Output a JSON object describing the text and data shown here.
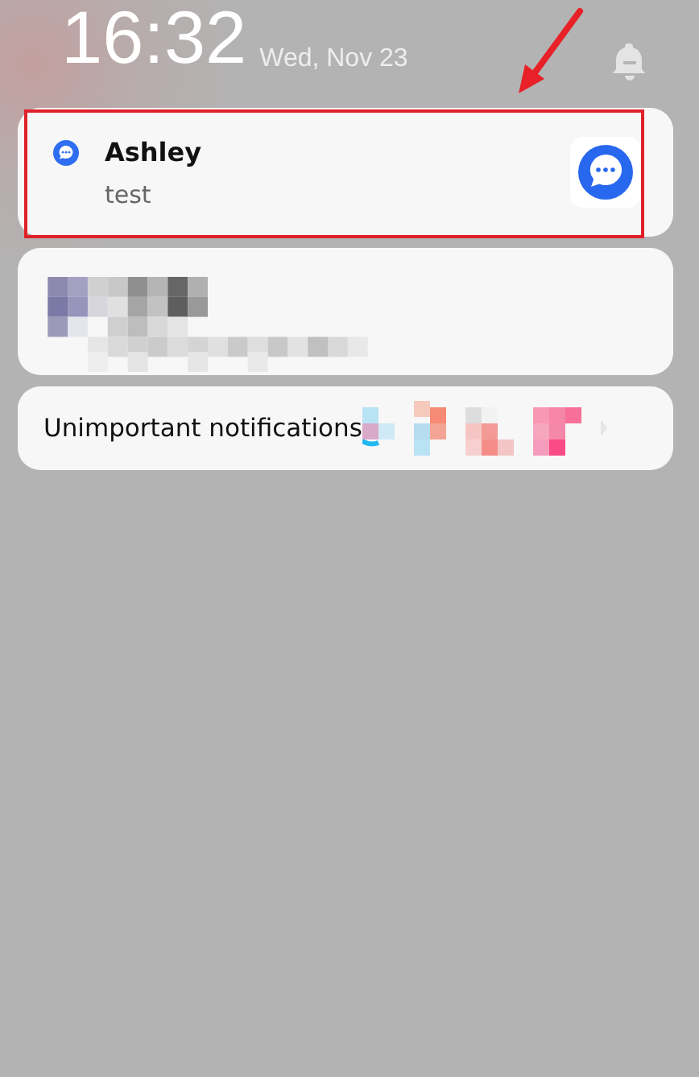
{
  "lock_screen": {
    "time": "16:32",
    "date": "Wed, Nov 23"
  },
  "notification": {
    "title": "Ashley",
    "body": "test",
    "highlighted": true
  },
  "summary": {
    "label": "Unimportant notifications"
  }
}
